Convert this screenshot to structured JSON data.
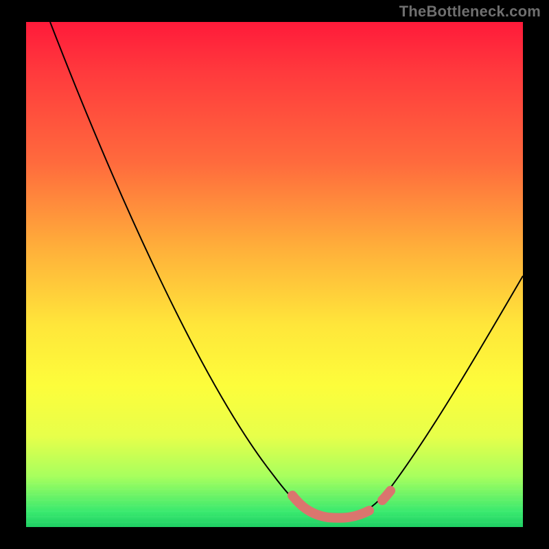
{
  "attribution": "TheBottleneck.com",
  "colors": {
    "overlay_stroke": "#da756e",
    "curve_stroke": "#000000",
    "gradient_top": "#ff1a3a",
    "gradient_bottom": "#1fcf64"
  },
  "chart_data": {
    "type": "line",
    "title": "",
    "xlabel": "",
    "ylabel": "",
    "xlim": [
      0,
      100
    ],
    "ylim": [
      0,
      100
    ],
    "x": [
      0,
      10,
      20,
      30,
      40,
      50,
      55,
      58,
      62,
      66,
      70,
      75,
      80,
      85,
      90,
      95,
      100
    ],
    "y": [
      100,
      83,
      67,
      50,
      34,
      18,
      10,
      6,
      3,
      2,
      3,
      7,
      15,
      24,
      33,
      42,
      51
    ],
    "highlight_range_x": [
      55,
      70
    ],
    "highlight_y": 2
  }
}
